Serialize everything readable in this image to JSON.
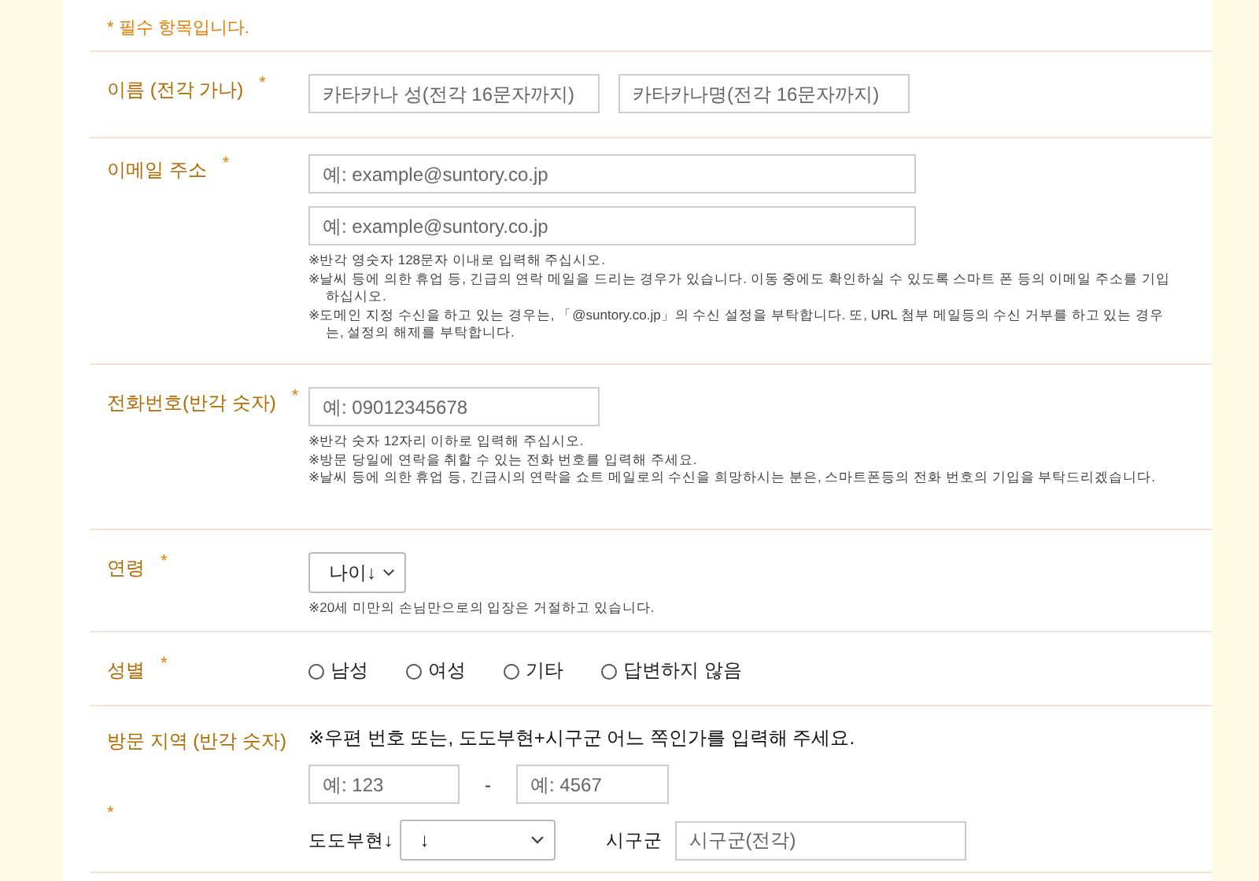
{
  "required_note": "* 필수 항목입니다.",
  "fields": [
    {
      "kind": "inline",
      "label": "이름 (전각 가나)",
      "required_mark": "*",
      "inputs": [
        {
          "placeholder": "카타카나 성(전각 16문자까지)"
        },
        {
          "placeholder": "카타카나명(전각 16문자까지)"
        }
      ]
    },
    {
      "kind": "stacked",
      "label": "이메일 주소",
      "required_mark": "*",
      "inputs": [
        {
          "placeholder": "예: example@suntory.co.jp"
        },
        {
          "placeholder": "예: example@suntory.co.jp"
        }
      ],
      "notes": [
        "※반각 영숫자 128문자 이내로 입력해 주십시오.",
        "※날씨 등에 의한 휴업 등, 긴급의 연락 메일을 드리는 경우가 있습니다. 이동 중에도 확인하실 수 있도록 스마트 폰 등의 이메일 주소를 기입하십시오.",
        "※도메인 지정 수신을 하고 있는 경우는, 「@suntory.co.jp」의 수신 설정을 부탁합니다. 또, URL 첨부 메일등의 수신 거부를 하고 있는 경우는, 설정의 해제를 부탁합니다."
      ]
    },
    {
      "kind": "stacked",
      "label": "전화번호(반각 숫자)",
      "required_mark": "*",
      "inputs": [
        {
          "placeholder": "예: 09012345678"
        }
      ],
      "notes": [
        "※반각 숫자 12자리 이하로 입력해 주십시오.",
        "※방문 당일에 연락을 취할 수 있는 전화 번호를 입력해 주세요.",
        "※날씨 등에 의한 휴업 등, 긴급시의 연락을 쇼트 메일로의 수신을 희망하시는 분은, 스마트폰등의 전화 번호의 기입을 부탁드리겠습니다."
      ]
    },
    {
      "kind": "select",
      "label": "연령",
      "required_mark": "*",
      "value": "나이↓",
      "notes": [
        "※20세 미만의 손님만으로의 입장은 거절하고 있습니다."
      ]
    },
    {
      "kind": "radio",
      "label": "성별",
      "required_mark": "*",
      "options": [
        {
          "label": "남성",
          "selected": false
        },
        {
          "label": "여성",
          "selected": false
        },
        {
          "label": "기타",
          "selected": false
        },
        {
          "label": "답변하지 않음",
          "selected": false
        }
      ]
    },
    {
      "kind": "address",
      "label": "방문 지역 (반각 숫자)",
      "required_mark": "*",
      "instruction": "※우편 번호 또는, 도도부현+시구군 어느 쪽인가를 입력해 주세요.",
      "postal": [
        {
          "placeholder": "예: 123"
        },
        {
          "placeholder": "예: 4567"
        }
      ],
      "separator": "-",
      "prefecture_label": "도도부현↓",
      "prefecture_value": "↓",
      "city_label": "시구군",
      "city_placeholder": "시구군(전각)"
    }
  ]
}
